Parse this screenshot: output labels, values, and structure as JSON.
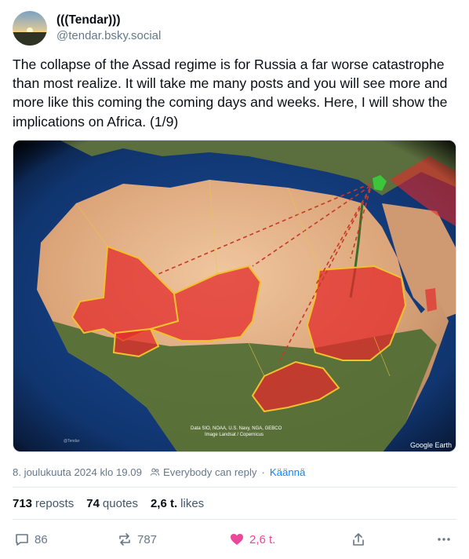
{
  "author": {
    "display_name": "(((Tendar)))",
    "handle": "@tendar.bsky.social"
  },
  "post": {
    "text": "The collapse of the Assad regime is for Russia a far worse catastrophe than most realize. It will take me many posts and you will see more and more like this coming the coming days and weeks. Here, I will show the implications on Africa. (1/9)"
  },
  "image": {
    "credit_line1": "Data SIO, NOAA, U.S. Navy, NGA, GEBCO",
    "credit_line2": "Image Landsat / Copernicus",
    "watermark": "Google Earth",
    "small_tag": "@Tendar"
  },
  "meta": {
    "date": "8. joulukuuta 2024 klo 19.09",
    "reply_setting": "Everybody can reply",
    "separator": "·",
    "translate": "Käännä"
  },
  "counts": {
    "reposts_value": "713",
    "reposts_label": "reposts",
    "quotes_value": "74",
    "quotes_label": "quotes",
    "likes_value": "2,6 t.",
    "likes_label": "likes"
  },
  "actions": {
    "reply_count": "86",
    "repost_count": "787",
    "like_count": "2,6 t."
  },
  "colors": {
    "like_active": "#ec4899",
    "link": "#1083fe",
    "muted": "#66788a",
    "highlight_red": "#e32b2b",
    "border_yellow": "#f2c12e"
  },
  "icons": [
    "comment-icon",
    "repost-icon",
    "heart-icon",
    "share-icon",
    "more-icon",
    "people-icon"
  ]
}
